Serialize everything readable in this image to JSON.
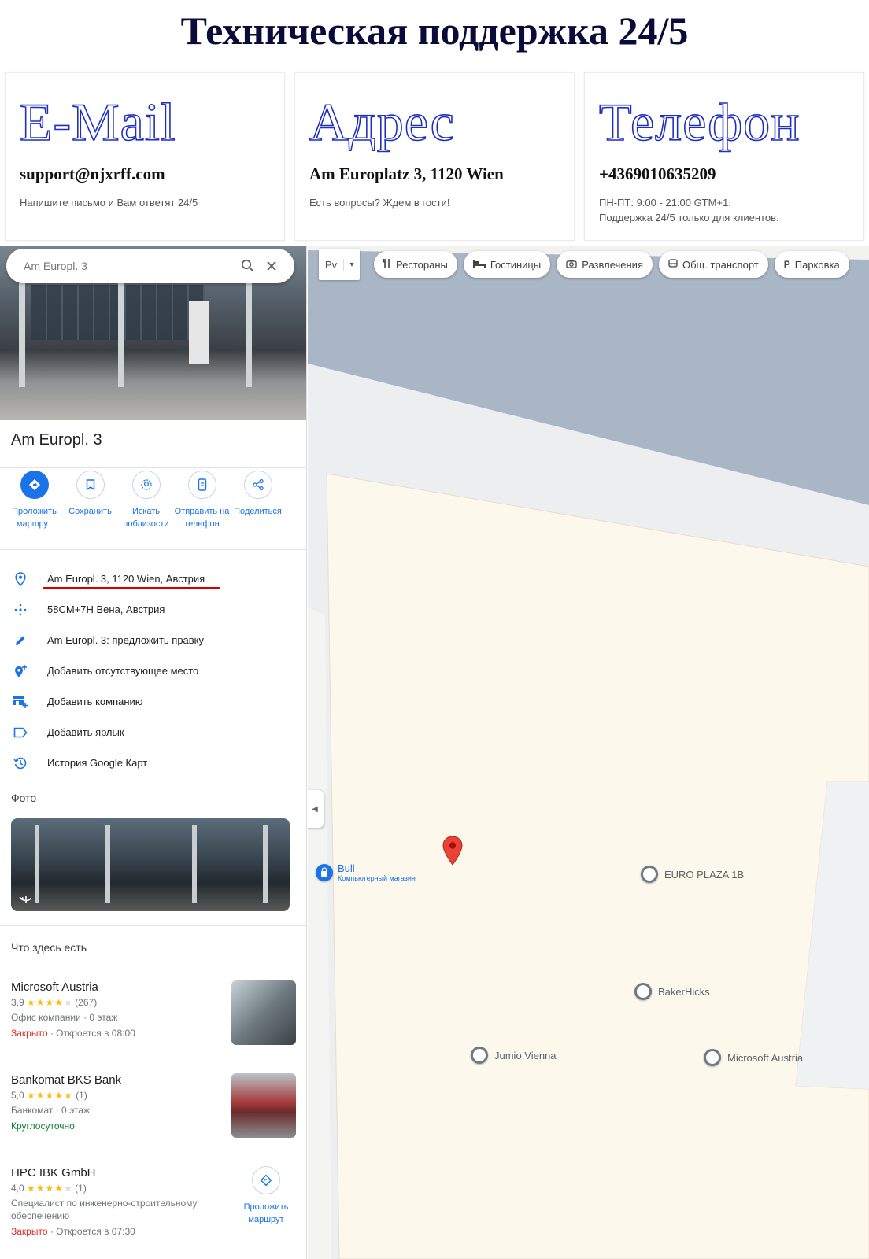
{
  "header": {
    "title": "Техническая поддержка 24/5"
  },
  "cards": [
    {
      "heading": "E-Mail",
      "value": "support@njxrff.com",
      "note": "Напишите письмо и Вам ответят 24/5"
    },
    {
      "heading": "Адрес",
      "value": "Am Europlatz 3, 1120 Wien",
      "note": "Есть вопросы? Ждем в гости!"
    },
    {
      "heading": "Телефон",
      "value": "+4369010635209",
      "note_line1": "ПН-ПТ: 9:00 - 21:00 GTM+1.",
      "note_line2": "Поддержка 24/5 только для клиентов."
    }
  ],
  "search": {
    "value": "Am Europl. 3"
  },
  "place": {
    "title": "Am Europl. 3"
  },
  "actions": [
    {
      "label": "Проложить маршрут"
    },
    {
      "label": "Сохранить"
    },
    {
      "label": "Искать поблизости"
    },
    {
      "label": "Отправить на телефон"
    },
    {
      "label": "Поделиться"
    }
  ],
  "info": [
    {
      "text": "Am Europl. 3, 1120 Wien, Австрия",
      "icon": "location-pin-icon"
    },
    {
      "text": "58CM+7H Вена, Австрия",
      "icon": "plus-code-icon"
    },
    {
      "text": "Am Europl. 3: предложить правку",
      "icon": "pencil-icon"
    },
    {
      "text": "Добавить отсутствующее место",
      "icon": "add-place-icon"
    },
    {
      "text": "Добавить компанию",
      "icon": "add-business-icon"
    },
    {
      "text": "Добавить ярлык",
      "icon": "label-icon"
    },
    {
      "text": "История Google Карт",
      "icon": "history-icon"
    }
  ],
  "photos_heading": "Фото",
  "here_heading": "Что здесь есть",
  "businesses": [
    {
      "name": "Microsoft Austria",
      "rating": "3,9",
      "stars": "★★★★",
      "stars_empty": "★",
      "reviews": "(267)",
      "type": "Офис компании · 0 этаж",
      "status": "Закрыто",
      "status_rest": " · Откроется в 08:00"
    },
    {
      "name": "Bankomat BKS Bank",
      "rating": "5,0",
      "stars": "★★★★★",
      "stars_empty": "",
      "reviews": "(1)",
      "type": "Банкомат · 0 этаж",
      "status": "Круглосуточно",
      "status_rest": ""
    },
    {
      "name": "HPC IBK GmbH",
      "rating": "4,0",
      "stars": "★★★★",
      "stars_empty": "★",
      "reviews": "(1)",
      "type": "Специалист по инженерно-строительному обеспечению",
      "status": "Закрыто",
      "status_rest": " · Откроется в 07:30",
      "route_label": "Проложить маршрут"
    }
  ],
  "map": {
    "lang": "Pv",
    "chips": [
      "Рестораны",
      "Гостиницы",
      "Развлечения",
      "Общ. транспорт",
      "Парковка"
    ],
    "pois": [
      {
        "name": "Bull",
        "sub": "Компьютерный магазин"
      },
      {
        "name": "EURO PLAZA 1B"
      },
      {
        "name": "BakerHicks"
      },
      {
        "name": "Jumio Vienna"
      },
      {
        "name": "Microsoft Austria"
      }
    ]
  },
  "colors": {
    "accent": "#1a73e8",
    "pin": "#ea4335",
    "underline": "#d40000",
    "heading_outline": "#1f2fc4"
  }
}
